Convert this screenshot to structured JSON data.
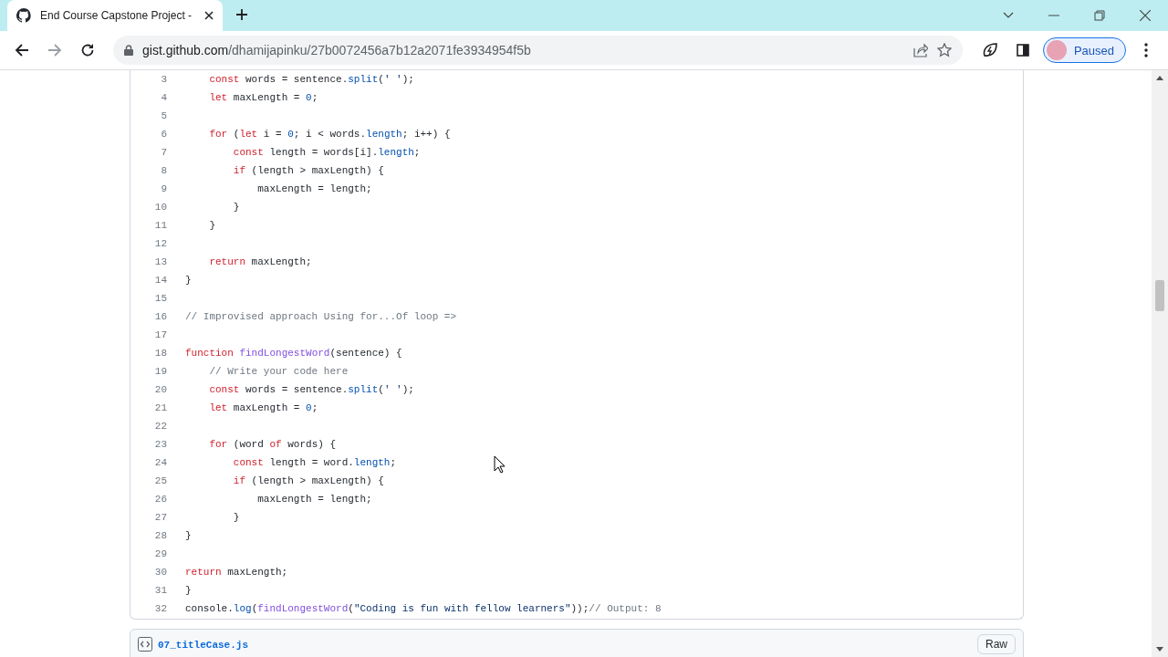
{
  "browser": {
    "tab": {
      "title": "End Course Capstone Project -",
      "selected": true
    },
    "url": {
      "domain": "gist.github.com",
      "path": "/dhamijapinku/27b0072456a7b12a2071fe3934954f5b"
    },
    "profile": {
      "label": "Paused"
    }
  },
  "code": {
    "lines": [
      {
        "number": "3",
        "tokens": [
          {
            "kind": "keyword",
            "text": "    const"
          },
          {
            "kind": "plain",
            "text": " words = sentence."
          },
          {
            "kind": "property",
            "text": "split"
          },
          {
            "kind": "plain",
            "text": "("
          },
          {
            "kind": "string",
            "text": "' '"
          },
          {
            "kind": "plain",
            "text": ");"
          }
        ]
      },
      {
        "number": "4",
        "tokens": [
          {
            "kind": "keyword",
            "text": "    let"
          },
          {
            "kind": "plain",
            "text": " maxLength = "
          },
          {
            "kind": "number",
            "text": "0"
          },
          {
            "kind": "plain",
            "text": ";"
          }
        ]
      },
      {
        "number": "5"
      },
      {
        "number": "6",
        "tokens": [
          {
            "kind": "keyword",
            "text": "    for"
          },
          {
            "kind": "plain",
            "text": " ("
          },
          {
            "kind": "keyword",
            "text": "let"
          },
          {
            "kind": "plain",
            "text": " i = "
          },
          {
            "kind": "number",
            "text": "0"
          },
          {
            "kind": "plain",
            "text": "; i < words."
          },
          {
            "kind": "property",
            "text": "length"
          },
          {
            "kind": "plain",
            "text": "; i++) {"
          }
        ]
      },
      {
        "number": "7",
        "tokens": [
          {
            "kind": "keyword",
            "text": "        const"
          },
          {
            "kind": "plain",
            "text": " length = words[i]."
          },
          {
            "kind": "property",
            "text": "length"
          },
          {
            "kind": "plain",
            "text": ";"
          }
        ]
      },
      {
        "number": "8",
        "tokens": [
          {
            "kind": "keyword",
            "text": "        if"
          },
          {
            "kind": "plain",
            "text": " (length > maxLength) {"
          }
        ]
      },
      {
        "number": "9",
        "tokens": [
          {
            "kind": "plain",
            "text": "            maxLength = length;"
          }
        ]
      },
      {
        "number": "10",
        "tokens": [
          {
            "kind": "plain",
            "text": "        }"
          }
        ]
      },
      {
        "number": "11",
        "tokens": [
          {
            "kind": "plain",
            "text": "    }"
          }
        ]
      },
      {
        "number": "12"
      },
      {
        "number": "13",
        "tokens": [
          {
            "kind": "keyword",
            "text": "    return"
          },
          {
            "kind": "plain",
            "text": " maxLength;"
          }
        ]
      },
      {
        "number": "14",
        "tokens": [
          {
            "kind": "plain",
            "text": "}"
          }
        ]
      },
      {
        "number": "15"
      },
      {
        "number": "16",
        "tokens": [
          {
            "kind": "comment",
            "text": "// Improvised approach Using for...Of loop =>"
          }
        ]
      },
      {
        "number": "17"
      },
      {
        "number": "18",
        "tokens": [
          {
            "kind": "keyword",
            "text": "function "
          },
          {
            "kind": "function",
            "text": "findLongestWord"
          },
          {
            "kind": "plain",
            "text": "(sentence) {"
          }
        ]
      },
      {
        "number": "19",
        "tokens": [
          {
            "kind": "comment",
            "text": "    // Write your code here"
          }
        ]
      },
      {
        "number": "20",
        "tokens": [
          {
            "kind": "keyword",
            "text": "    const"
          },
          {
            "kind": "plain",
            "text": " words = sentence."
          },
          {
            "kind": "property",
            "text": "split"
          },
          {
            "kind": "plain",
            "text": "("
          },
          {
            "kind": "string",
            "text": "' '"
          },
          {
            "kind": "plain",
            "text": ");"
          }
        ]
      },
      {
        "number": "21",
        "tokens": [
          {
            "kind": "keyword",
            "text": "    let"
          },
          {
            "kind": "plain",
            "text": " maxLength = "
          },
          {
            "kind": "number",
            "text": "0"
          },
          {
            "kind": "plain",
            "text": ";"
          }
        ]
      },
      {
        "number": "22"
      },
      {
        "number": "23",
        "tokens": [
          {
            "kind": "keyword",
            "text": "    for"
          },
          {
            "kind": "plain",
            "text": " (word "
          },
          {
            "kind": "keyword",
            "text": "of"
          },
          {
            "kind": "plain",
            "text": " words) {"
          }
        ]
      },
      {
        "number": "24",
        "tokens": [
          {
            "kind": "keyword",
            "text": "        const"
          },
          {
            "kind": "plain",
            "text": " length = word."
          },
          {
            "kind": "property",
            "text": "length"
          },
          {
            "kind": "plain",
            "text": ";"
          }
        ]
      },
      {
        "number": "25",
        "tokens": [
          {
            "kind": "keyword",
            "text": "        if"
          },
          {
            "kind": "plain",
            "text": " (length > maxLength) {"
          }
        ]
      },
      {
        "number": "26",
        "tokens": [
          {
            "kind": "plain",
            "text": "            maxLength = length;"
          }
        ]
      },
      {
        "number": "27",
        "tokens": [
          {
            "kind": "plain",
            "text": "        }"
          }
        ]
      },
      {
        "number": "28",
        "tokens": [
          {
            "kind": "plain",
            "text": "}"
          }
        ]
      },
      {
        "number": "29"
      },
      {
        "number": "30",
        "tokens": [
          {
            "kind": "keyword",
            "text": "return"
          },
          {
            "kind": "plain",
            "text": " maxLength;"
          }
        ]
      },
      {
        "number": "31",
        "tokens": [
          {
            "kind": "plain",
            "text": "}"
          }
        ]
      },
      {
        "number": "32",
        "tokens": [
          {
            "kind": "plain",
            "text": "console."
          },
          {
            "kind": "property",
            "text": "log"
          },
          {
            "kind": "plain",
            "text": "("
          },
          {
            "kind": "function",
            "text": "findLongestWord"
          },
          {
            "kind": "plain",
            "text": "("
          },
          {
            "kind": "string",
            "text": "\"Coding is fun with fellow learners\""
          },
          {
            "kind": "plain",
            "text": "));"
          },
          {
            "kind": "comment",
            "text": "// Output: 8"
          }
        ]
      }
    ]
  },
  "next_file": {
    "name": "07_titleCase.js",
    "button": "Raw"
  }
}
